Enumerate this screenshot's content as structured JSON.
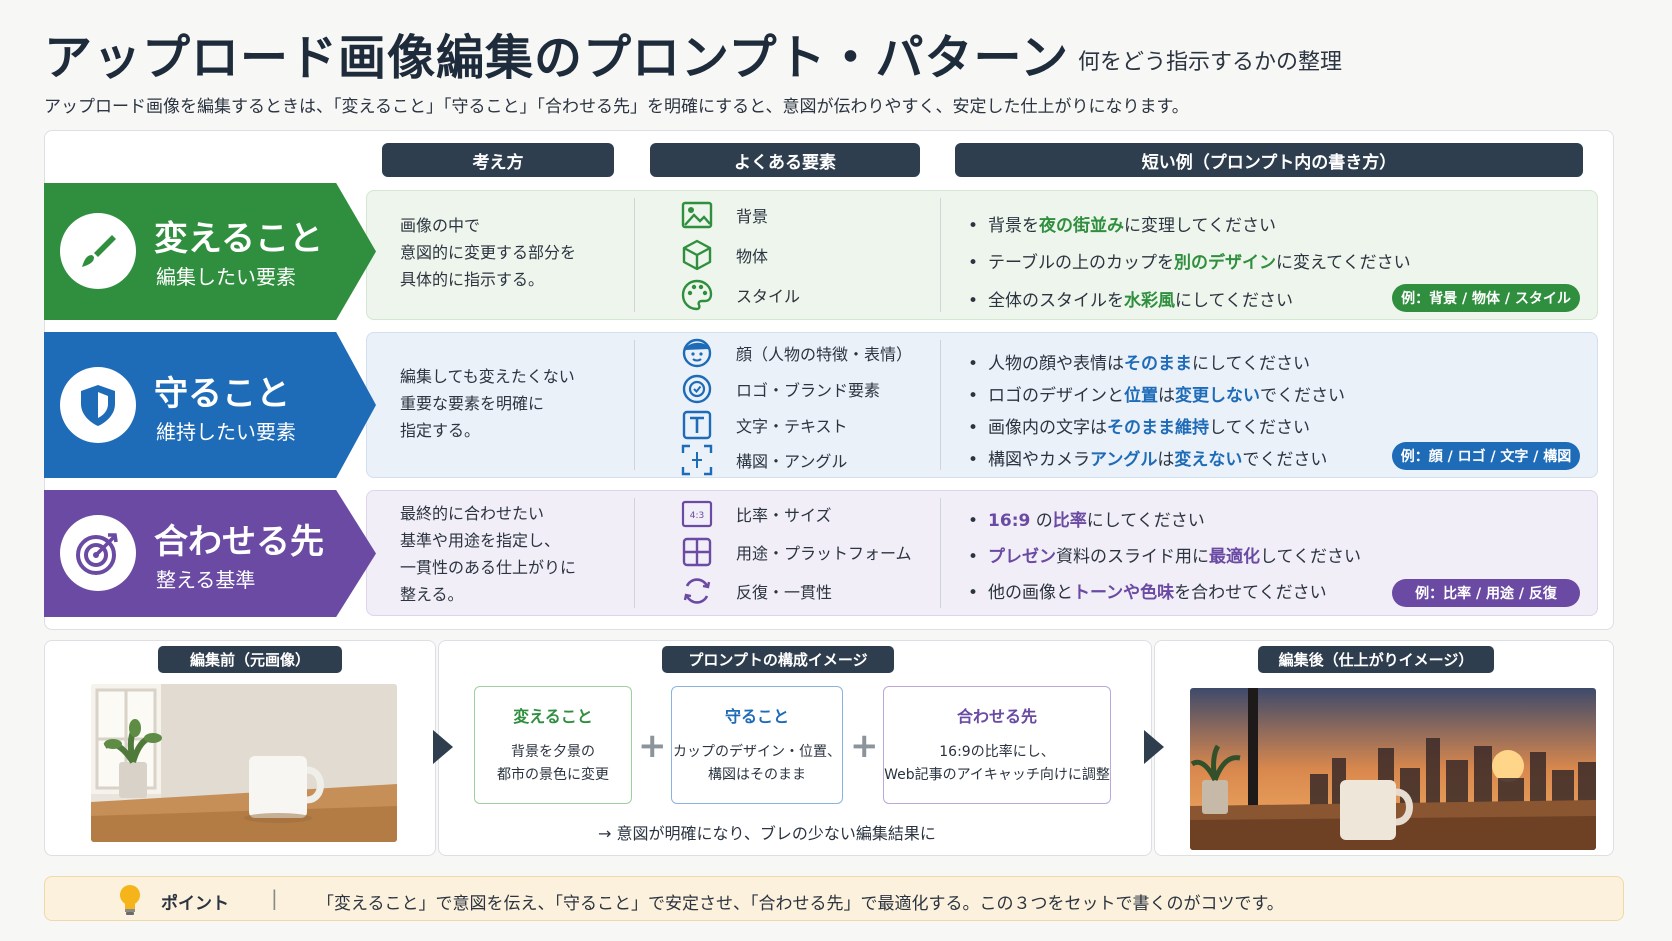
{
  "header": {
    "title": "アップロード画像編集のプロンプト・パターン",
    "subtitle": "何をどう指示するかの整理",
    "lead": "アップロード画像を編集するときは、「変えること」「守ること」「合わせる先」を明確にすると、意図が伝わりやすく、安定した仕上がりになります。"
  },
  "columns": {
    "approach": "考え方",
    "elements": "よくある要素",
    "examples": "短い例（プロンプト内の書き方）"
  },
  "rows": {
    "change": {
      "title": "変えること",
      "sub": "編集したい要素",
      "desc": [
        "画像の中で",
        "意図的に変更する部分を",
        "具体的に指示する。"
      ],
      "elements": [
        {
          "icon": "image-icon",
          "label": "背景"
        },
        {
          "icon": "cube-icon",
          "label": "物体"
        },
        {
          "icon": "palette-icon",
          "label": "スタイル"
        }
      ],
      "examples": [
        {
          "pre": "背景を",
          "hl": "夜の街並み",
          "post": "に変理してください"
        },
        {
          "pre": "テーブルの上のカップを",
          "hl": "別のデザイン",
          "post": "に変えてください"
        },
        {
          "pre": "全体のスタイルを",
          "hl": "水彩風",
          "post": "にしてください"
        }
      ],
      "tag": "例：背景 / 物体 / スタイル",
      "color": "#2f8f3e"
    },
    "keep": {
      "title": "守ること",
      "sub": "維持したい要素",
      "desc": [
        "編集しても変えたくない",
        "重要な要素を明確に",
        "指定する。"
      ],
      "elements": [
        {
          "icon": "face-icon",
          "label": "顔（人物の特徴・表情）"
        },
        {
          "icon": "badge-icon",
          "label": "ロゴ・ブランド要素"
        },
        {
          "icon": "text-icon",
          "label": "文字・テキスト"
        },
        {
          "icon": "frame-icon",
          "label": "構図・アングル"
        }
      ],
      "examples": [
        {
          "pre": "人物の顔や表情は",
          "hl": "そのまま",
          "post": "にしてください"
        },
        {
          "pre": "ロゴのデザインと",
          "hl": "位置",
          "mid": "は",
          "hl2": "変更しない",
          "post": "でください"
        },
        {
          "pre": "画像内の文字は",
          "hl": "そのまま維持",
          "post": "してください"
        },
        {
          "pre": "構図やカメラ",
          "hl": "アングル",
          "mid": "は",
          "hl2": "変えない",
          "post": "でください"
        }
      ],
      "tag": "例：顔 / ロゴ / 文字 / 構図",
      "color": "#1e6bb8"
    },
    "target": {
      "title": "合わせる先",
      "sub": "整える基準",
      "desc": [
        "最終的に合わせたい",
        "基準や用途を指定し、",
        "一貫性のある仕上がりに",
        "整える。"
      ],
      "elements": [
        {
          "icon": "ratio-icon",
          "label": "比率・サイズ"
        },
        {
          "icon": "grid-icon",
          "label": "用途・プラットフォーム"
        },
        {
          "icon": "cycle-icon",
          "label": "反復・一貫性"
        }
      ],
      "examples": [
        {
          "pre": "",
          "hl": "16:9",
          "mid": " の",
          "hl2": "比率",
          "post": "にしてください"
        },
        {
          "pre": "",
          "hl": "プレゼン",
          "mid": "資料のスライド用に",
          "hl2": "最適化",
          "post": "してください"
        },
        {
          "pre": "他の画像と",
          "hl": "トーンや色味",
          "post": "を合わせてください"
        }
      ],
      "tag": "例：比率 / 用途 / 反復",
      "color": "#6a4aa3"
    }
  },
  "flow": {
    "before_title": "編集前（元画像）",
    "compose_title": "プロンプトの構成イメージ",
    "after_title": "編集後（仕上がりイメージ）",
    "boxes": [
      {
        "head": "変えること",
        "l1": "背景を夕景の",
        "l2": "都市の景色に変更"
      },
      {
        "head": "守ること",
        "l1": "カップのデザイン・位置、",
        "l2": "構図はそのまま"
      },
      {
        "head": "合わせる先",
        "l1": "16:9の比率にし、",
        "l2": "Web記事のアイキャッチ向けに調整"
      }
    ],
    "plus": "+",
    "result": "→ 意図が明確になり、ブレの少ない編集結果に"
  },
  "point": {
    "label": "ポイント",
    "separator": "|",
    "text": "「変えること」で意図を伝え、「守ること」で安定させ、「合わせる先」で最適化する。この３つをセットで書くのがコツです。"
  }
}
